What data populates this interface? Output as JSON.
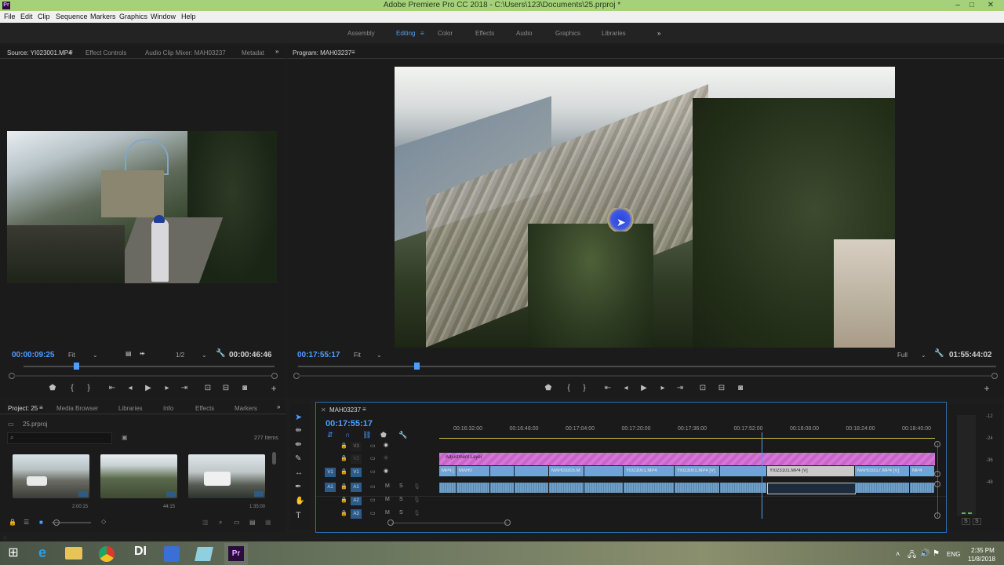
{
  "titlebar": {
    "title": "Adobe Premiere Pro CC 2018 - C:\\Users\\123\\Documents\\25.prproj *",
    "app_icon": "Pr",
    "minimize": "–",
    "maximize": "□",
    "close": "✕"
  },
  "menu": [
    "File",
    "Edit",
    "Clip",
    "Sequence",
    "Markers",
    "Graphics",
    "Window",
    "Help"
  ],
  "workspaces": {
    "items": [
      "Assembly",
      "Editing",
      "Color",
      "Effects",
      "Audio",
      "Graphics",
      "Libraries"
    ],
    "active": "Editing",
    "more": "»"
  },
  "source": {
    "tabs": [
      "Source: YI023001.MP4",
      "Effect Controls",
      "Audio Clip Mixer: MAH03237",
      "Metadat"
    ],
    "menu_icon": "≡",
    "more": "»",
    "timecode": "00:00:09:25",
    "fit": "Fit",
    "resolution": "1/2",
    "duration": "00:00:46:46",
    "playhead_fraction": 0.21
  },
  "program": {
    "tab": "Program: MAH03237",
    "menu_icon": "≡",
    "timecode": "00:17:55:17",
    "fit": "Fit",
    "quality": "Full",
    "duration": "01:55:44:02",
    "playhead_fraction": 0.17
  },
  "project": {
    "tabs": [
      "Project: 25",
      "Media Browser",
      "Libraries",
      "Info",
      "Effects",
      "Markers"
    ],
    "menu_icon": "≡",
    "more": "»",
    "file": "25.prproj",
    "search_placeholder": "",
    "items_count": "277 Items",
    "thumbs": [
      {
        "duration": "2:00:15"
      },
      {
        "duration": "44:15"
      },
      {
        "duration": "1:35:00"
      }
    ]
  },
  "timeline": {
    "tab": "MAH03237",
    "menu_icon": "≡",
    "timecode": "00:17:55:17",
    "ruler": [
      "00:16:32:00",
      "00:16:48:00",
      "00:17:04:00",
      "00:17:20:00",
      "00:17:36:00",
      "00:17:52:00",
      "00:18:08:00",
      "00:18:24:00",
      "00:18:40:00"
    ],
    "video_tracks": [
      "V3",
      "V2",
      "V1"
    ],
    "audio_tracks": [
      "A1",
      "A2",
      "A3"
    ],
    "source_v": "V1",
    "source_a": "A1",
    "track_m": "M",
    "track_s": "S",
    "adjustment_layer": "Adjustment Layer",
    "clips_v1": [
      "MP4 [V]",
      "MAH0",
      "MAH03305.M",
      "YI023001.MP4",
      "YI023001.MP4 [V]",
      "YI023101.MP4 [V]",
      "MAH03317.MP4 [V]",
      "MP4"
    ],
    "playhead_fraction": 0.65
  },
  "meter": {
    "labels": [
      "-12",
      "-24",
      "-36",
      "-48"
    ],
    "s_left": "S",
    "s_right": "S"
  },
  "colors": {
    "accent": "#4e9eff",
    "titlebar": "#a4d17a",
    "adjustment": "#d676d6",
    "video_clip": "#6fa5d6",
    "audio_clip": "#6e9fc8"
  },
  "taskbar": {
    "icons": [
      "windows-start-icon",
      "internet-explorer-icon",
      "file-explorer-icon",
      "chrome-icon",
      "daz-icon",
      "save-disk-icon",
      "app-blue-icon",
      "premiere-icon"
    ],
    "di_label": "DI",
    "pr_label": "Pr",
    "lang": "ENG",
    "time": "2:35 PM",
    "date": "11/8/2018"
  }
}
